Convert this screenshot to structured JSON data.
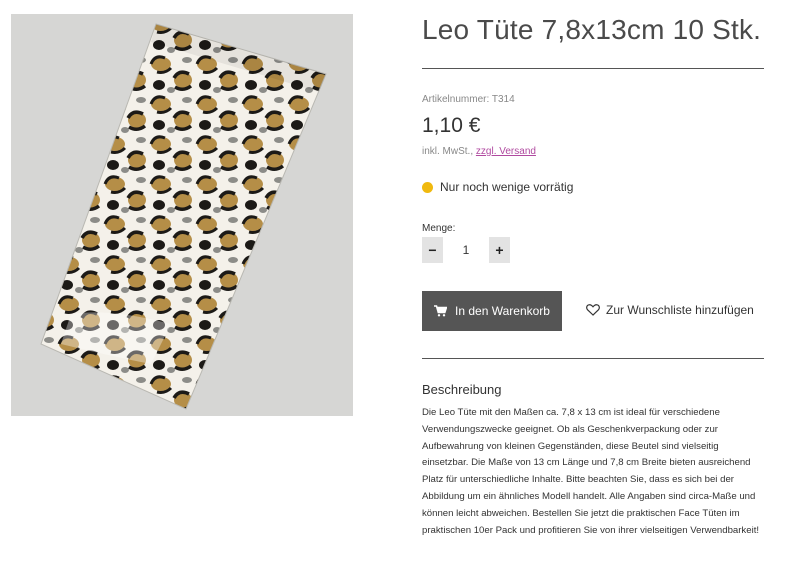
{
  "product": {
    "title": "Leo Tüte 7,8x13cm 10 Stk.",
    "sku": "Artikelnummer: T314",
    "price": "1,10 €",
    "tax_prefix": "inkl. MwSt.,",
    "shipping_link": "zzgl. Versand",
    "stock_status": "Nur noch wenige vorrätig",
    "stock_color": "#f0b90f"
  },
  "quantity": {
    "label": "Menge:",
    "value": "1",
    "minus": "−",
    "plus": "+"
  },
  "actions": {
    "cart_label": "In den Warenkorb",
    "cart_icon": "cart-icon",
    "wishlist_label": "Zur Wunschliste hinzufügen",
    "wishlist_icon": "heart-icon"
  },
  "description": {
    "heading": "Beschreibung",
    "text": "Die Leo Tüte mit den Maßen ca. 7,8 x 13 cm ist ideal für verschiedene Verwendungszwecke geeignet. Ob als Geschenkverpackung oder zur Aufbewahrung von kleinen Gegenständen, diese Beutel sind vielseitig einsetzbar. Die Maße von 13 cm Länge und 7,8 cm Breite bieten ausreichend Platz für unterschiedliche Inhalte. Bitte beachten Sie, dass es sich bei der Abbildung um ein ähnliches Modell handelt. Alle Angaben sind circa-Maße und können leicht abweichen. Bestellen Sie jetzt die praktischen Face Tüten im praktischen 10er Pack und profitieren Sie von ihrer vielseitigen Verwendbarkeit!"
  },
  "colors": {
    "button_bg": "#555555",
    "link": "#b04aa0"
  }
}
